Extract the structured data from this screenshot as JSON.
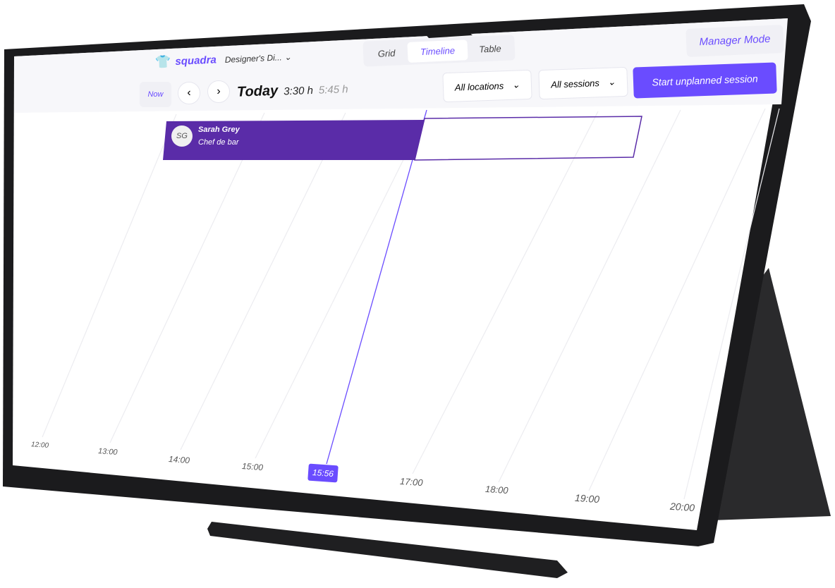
{
  "brand": {
    "name": "squadra",
    "workspace": "Designer's Di..."
  },
  "view_tabs": [
    {
      "label": "Grid"
    },
    {
      "label": "Timeline",
      "active": true
    },
    {
      "label": "Table"
    }
  ],
  "manager_mode": "Manager Mode",
  "toolbar": {
    "now": "Now",
    "title": "Today",
    "hours_done": "3:30 h",
    "hours_planned": "5:45 h",
    "locations": "All locations",
    "sessions": "All sessions",
    "start": "Start unplanned session"
  },
  "session": {
    "initials": "SG",
    "name": "Sarah Grey",
    "role": "Chef de bar"
  },
  "timeline": {
    "labels": [
      "12:00",
      "13:00",
      "14:00",
      "15:00",
      "17:00",
      "18:00",
      "19:00",
      "20:00"
    ],
    "current": "15:56"
  },
  "colors": {
    "accent": "#6a4cff",
    "session": "#5a2ca8",
    "frame": "#1b1b1d"
  }
}
